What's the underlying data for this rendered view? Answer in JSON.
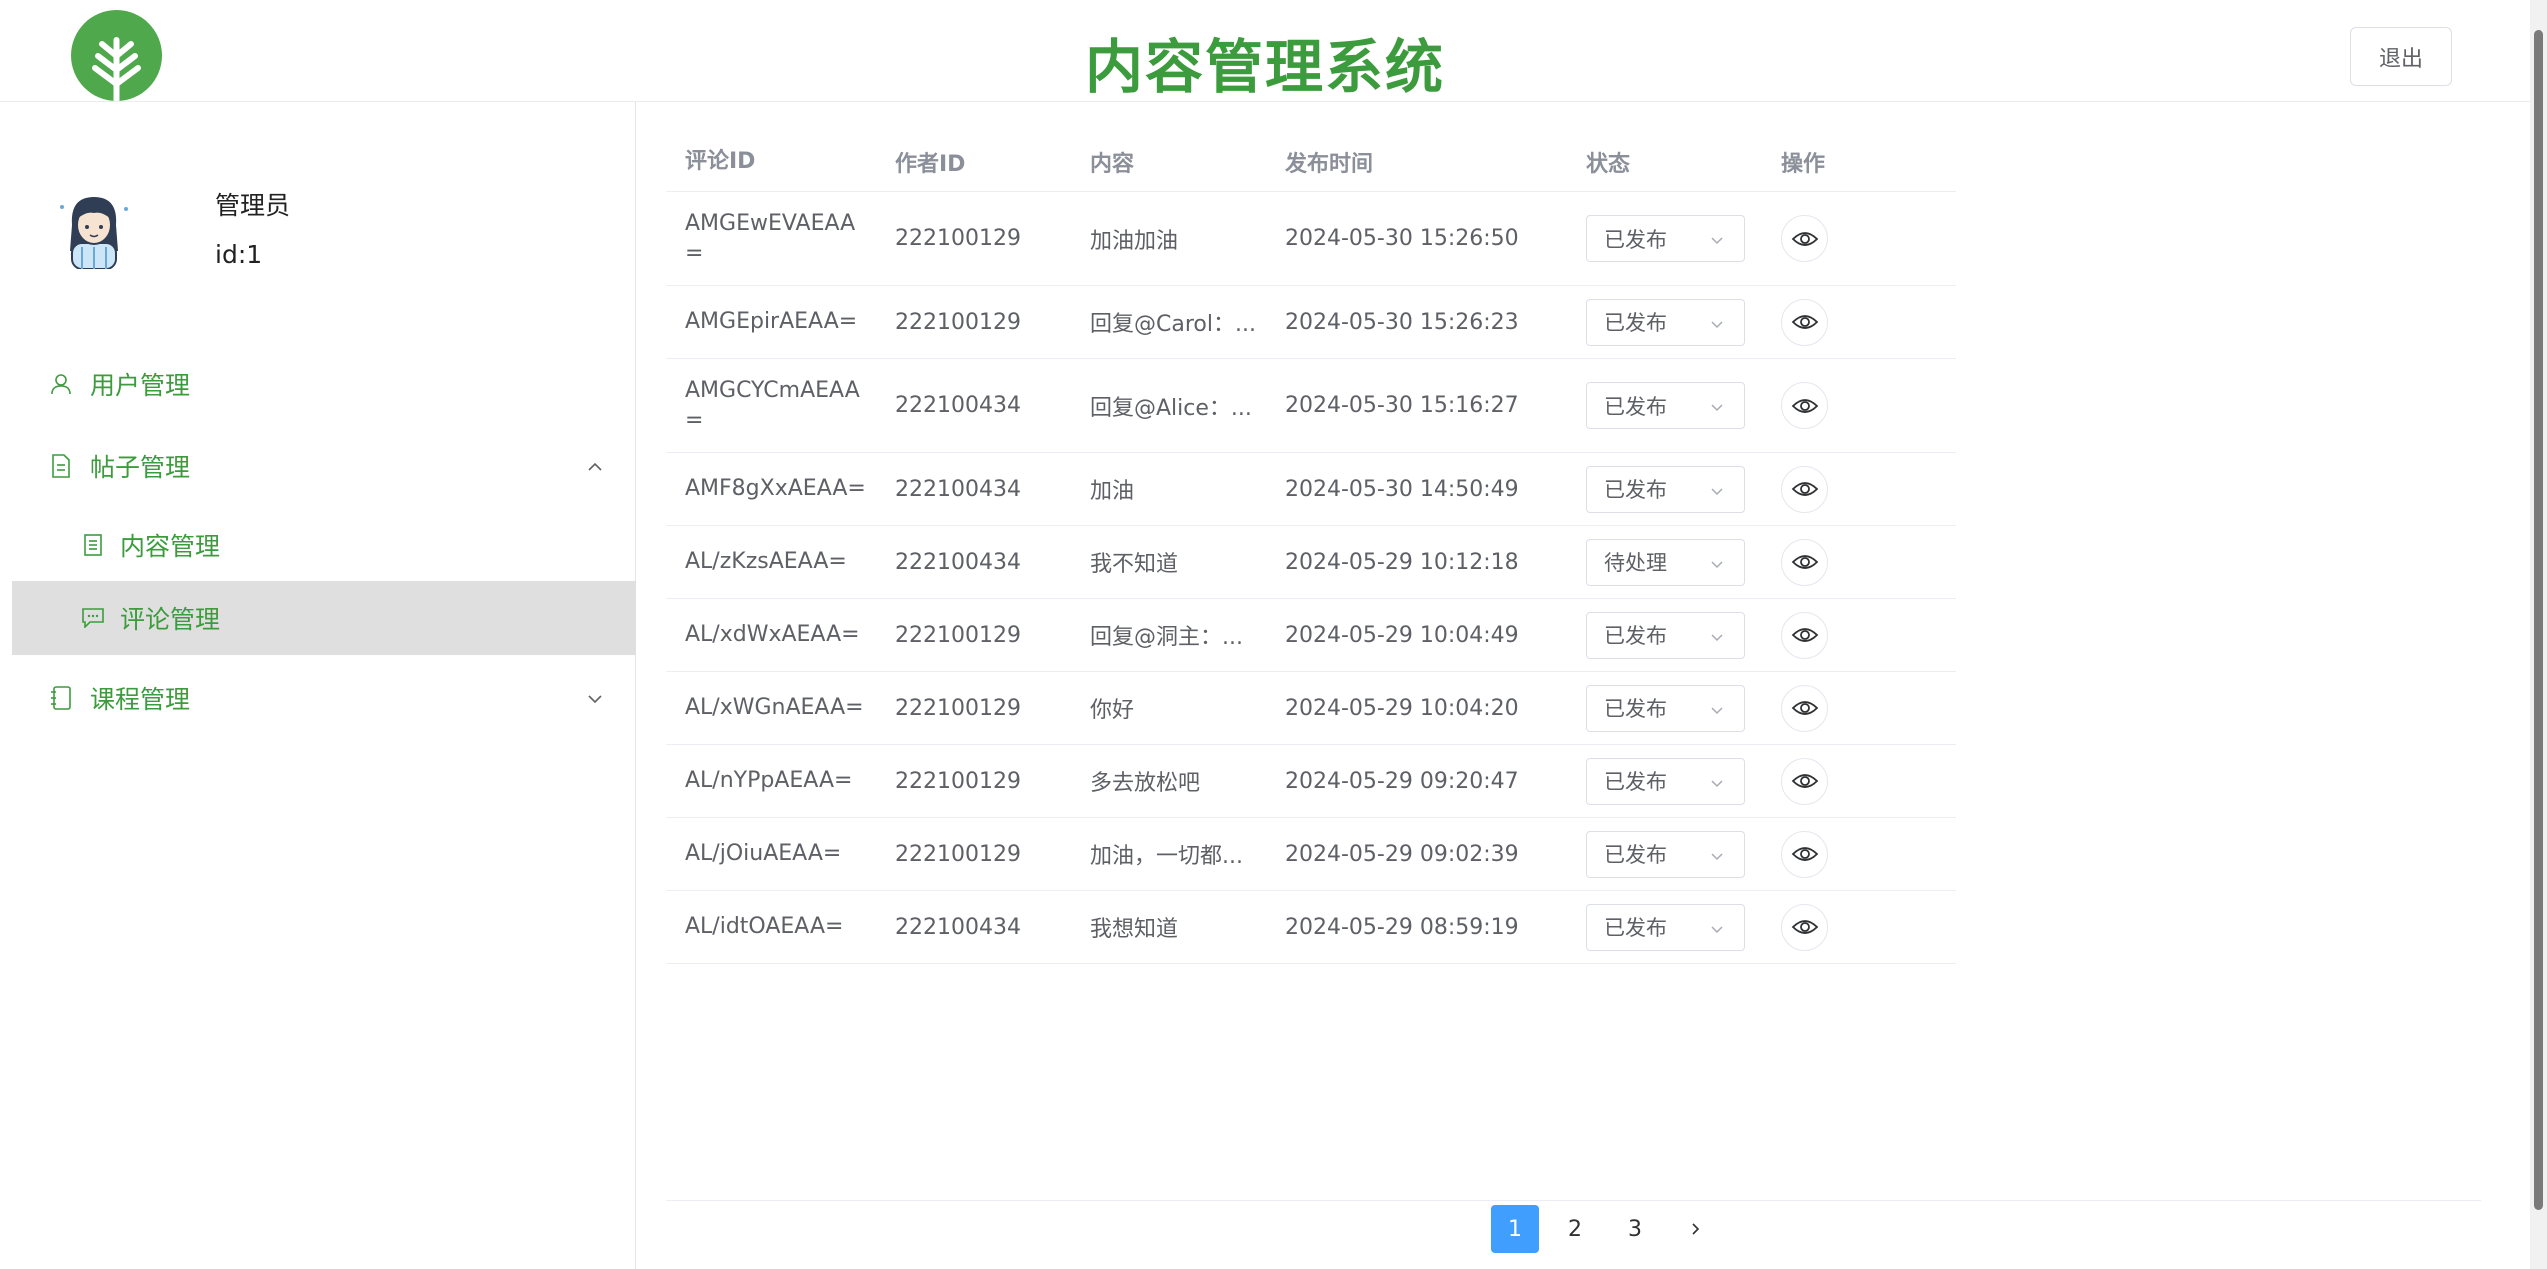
{
  "header": {
    "title": "内容管理系统",
    "logout_label": "退出"
  },
  "user": {
    "name": "管理员",
    "id_text": "id:1"
  },
  "sidebar": {
    "items": [
      {
        "label": "用户管理",
        "icon": "user-icon"
      },
      {
        "label": "帖子管理",
        "icon": "document-icon",
        "expanded": true
      },
      {
        "label": "内容管理",
        "icon": "document-icon"
      },
      {
        "label": "评论管理",
        "icon": "comment-icon",
        "active": true
      },
      {
        "label": "课程管理",
        "icon": "notebook-icon",
        "expanded": false
      }
    ]
  },
  "table": {
    "headers": [
      "评论ID",
      "作者ID",
      "内容",
      "发布时间",
      "状态",
      "操作"
    ],
    "rows": [
      {
        "id": "AMGEwEVAEAA=",
        "author": "222100129",
        "content": "加油加油",
        "time": "2024-05-30 15:26:50",
        "status": "已发布"
      },
      {
        "id": "AMGEpirAEAA=",
        "author": "222100129",
        "content": "回复@Carol：...",
        "time": "2024-05-30 15:26:23",
        "status": "已发布"
      },
      {
        "id": "AMGCYCmAEAA=",
        "author": "222100434",
        "content": "回复@Alice：...",
        "time": "2024-05-30 15:16:27",
        "status": "已发布"
      },
      {
        "id": "AMF8gXxAEAA=",
        "author": "222100434",
        "content": "加油",
        "time": "2024-05-30 14:50:49",
        "status": "已发布"
      },
      {
        "id": "AL/zKzsAEAA=",
        "author": "222100434",
        "content": "我不知道",
        "time": "2024-05-29 10:12:18",
        "status": "待处理"
      },
      {
        "id": "AL/xdWxAEAA=",
        "author": "222100129",
        "content": "回复@洞主：...",
        "time": "2024-05-29 10:04:49",
        "status": "已发布"
      },
      {
        "id": "AL/xWGnAEAA=",
        "author": "222100129",
        "content": "你好",
        "time": "2024-05-29 10:04:20",
        "status": "已发布"
      },
      {
        "id": "AL/nYPpAEAA=",
        "author": "222100129",
        "content": "多去放松吧",
        "time": "2024-05-29 09:20:47",
        "status": "已发布"
      },
      {
        "id": "AL/jOiuAEAA=",
        "author": "222100129",
        "content": "加油，一切都...",
        "time": "2024-05-29 09:02:39",
        "status": "已发布"
      },
      {
        "id": "AL/idtOAEAA=",
        "author": "222100434",
        "content": "我想知道",
        "time": "2024-05-29 08:59:19",
        "status": "已发布"
      }
    ]
  },
  "pagination": {
    "pages": [
      "1",
      "2",
      "3"
    ],
    "current": "1"
  },
  "colors": {
    "brand": "#3c9c3d",
    "logo": "#4fa94c",
    "pager_active": "#409eff",
    "active_menu_bg": "#e0dfdf"
  }
}
